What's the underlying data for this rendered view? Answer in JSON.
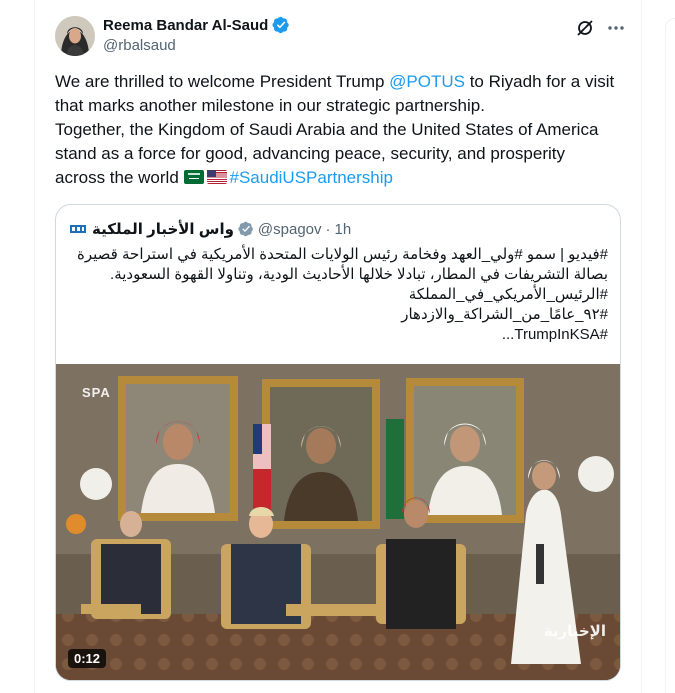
{
  "author": {
    "name": "Reema Bandar Al-Saud",
    "handle": "@rbalsaud",
    "verified_color": "#1d9bf0"
  },
  "tweet": {
    "line1_prefix": "We are thrilled to welcome President Trump ",
    "mention": "@POTUS",
    "line1_suffix": " to Riyadh for a visit",
    "line2": "that marks another milestone in our strategic partnership.",
    "line3": "Together, the Kingdom of Saudi Arabia and the United States of America",
    "line4": "stand as a force for good, advancing peace, security, and prosperity",
    "line5_prefix": "across the world ",
    "hashtag": "#SaudiUSPartnership",
    "flags": [
      "saudi-flag",
      "us-flag"
    ]
  },
  "quoted": {
    "name": "واس الأخبار الملكية",
    "handle": "@spagov",
    "separator": "·",
    "time": "1h",
    "lines": [
      "#فيديو | سمو #ولي_العهد وفخامة رئيس الولايات المتحدة الأمريكية في استراحة قصيرة",
      "بصالة التشريفات في المطار، تبادلا خلالها الأحاديث الودية، وتناولا القهوة السعودية.",
      "#الرئيس_الأمريكي_في_المملكة",
      "#٩٢_عامًا_من_الشراكة_والازدهار",
      "#TrumpInKSA..."
    ],
    "video": {
      "duration": "0:12",
      "watermark_left": "SPA",
      "watermark_right": "الإخبارية"
    }
  },
  "icons": {
    "grok": "grok-icon",
    "more": "more-icon"
  },
  "colors": {
    "link": "#1d9bf0",
    "text": "#0f1419",
    "muted": "#536471",
    "border": "#cfd9de"
  }
}
